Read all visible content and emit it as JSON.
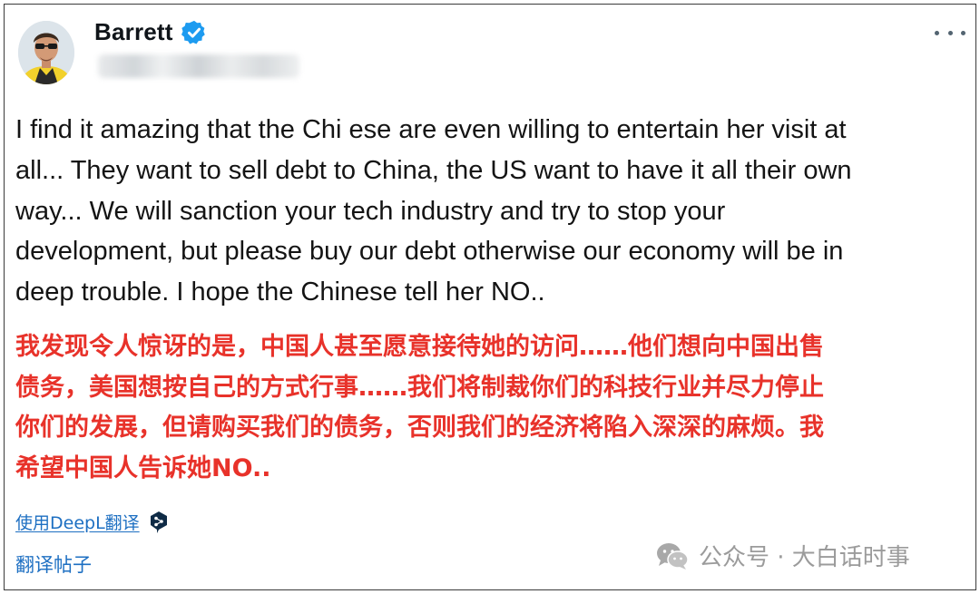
{
  "post": {
    "author_name": "Barrett",
    "more_label": "···",
    "text_en_lines": [
      "I find it amazing that the Chi ese are even willing to entertain her visit at",
      "all... They want to sell debt to China, the US want to have it all their own",
      "way... We will sanction your tech industry and try to stop your",
      "development, but please buy our debt otherwise our economy will be in",
      "deep trouble. I hope the Chinese tell her NO.."
    ],
    "text_zh_lines": [
      "我发现令人惊讶的是，中国人甚至愿意接待她的访问……他们想向中国出售",
      "债务，美国想按自己的方式行事……我们将制裁你们的科技行业并尽力停止",
      "你们的发展，但请购买我们的债务，否则我们的经济将陷入深深的麻烦。我",
      "希望中国人告诉她NO.."
    ],
    "deepl_link": "使用DeepL翻译",
    "translate_link": "翻译帖子"
  },
  "watermark": {
    "text": "公众号 · 大白话时事"
  },
  "icons": {
    "verified": "verified-badge-icon",
    "more": "more-options-icon",
    "deepl": "deepl-logo-icon",
    "wechat": "wechat-icon"
  },
  "colors": {
    "verified": "#1d9bf0",
    "link": "#1d6fc2",
    "translation_red": "#e8322a",
    "text": "#141414"
  }
}
